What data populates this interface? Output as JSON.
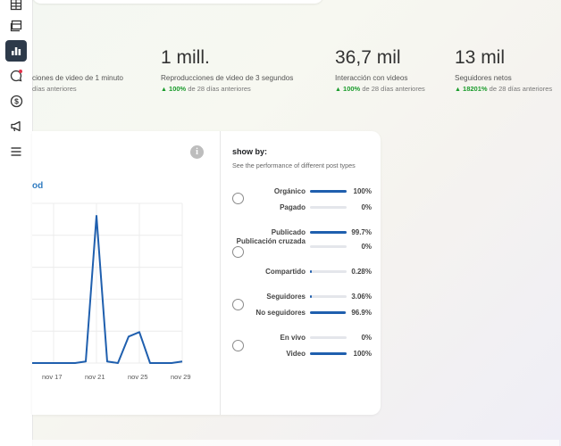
{
  "nav": {
    "items": [
      {
        "icon": "table-icon"
      },
      {
        "icon": "layers-icon"
      },
      {
        "icon": "bar-chart-icon",
        "active": true
      },
      {
        "icon": "chat-icon",
        "badge": true
      },
      {
        "icon": "dollar-icon"
      },
      {
        "icon": "megaphone-icon"
      },
      {
        "icon": "menu-icon"
      }
    ],
    "accent": "#2d3a4a",
    "badge_color": "#e4314b"
  },
  "metrics": [
    {
      "value": "",
      "label": "ciones de video de 1 minuto",
      "change_pct": "",
      "change_text": "días anteriores"
    },
    {
      "value": "1 mill.",
      "label": "Reproducciones de video de 3 segundos",
      "change_pct": "100%",
      "change_text": "de 28 días anteriores"
    },
    {
      "value": "36,7 mil",
      "label": "Interacción con videos",
      "change_pct": "100%",
      "change_text": "de 28 días anteriores"
    },
    {
      "value": "13 mil",
      "label": "Seguidores netos",
      "change_pct": "18201%",
      "change_text": "de 28 días anteriores"
    }
  ],
  "chart": {
    "partial_label": "od",
    "info_icon": "info-icon",
    "line_color": "#1f5fae"
  },
  "chart_data": {
    "type": "line",
    "x": [
      "nov 15",
      "nov 16",
      "nov 17",
      "nov 18",
      "nov 19",
      "nov 20",
      "nov 21",
      "nov 22",
      "nov 23",
      "nov 24",
      "nov 25",
      "nov 26",
      "nov 27",
      "nov 28",
      "nov 29"
    ],
    "y": [
      0,
      0,
      0,
      0,
      0,
      1,
      100,
      1,
      0,
      18,
      21,
      0,
      0,
      0,
      1
    ],
    "x_tick_labels": [
      "nov 17",
      "nov 21",
      "nov 25",
      "nov 29"
    ],
    "grid": true,
    "series": [
      {
        "values": [
          0,
          0,
          0,
          0,
          0,
          1,
          100,
          1,
          0,
          18,
          21,
          0,
          0,
          0,
          1
        ]
      }
    ]
  },
  "show_by": {
    "title": "show by:",
    "subtitle": "See the performance of different post types",
    "groups": [
      {
        "rows": [
          {
            "name": "Orgánico",
            "pct": "100%",
            "value": 100
          },
          {
            "name": "Pagado",
            "pct": "0%",
            "value": 0
          }
        ]
      },
      {
        "rows": [
          {
            "name": "Publicado",
            "pct": "99.7%",
            "value": 99.7
          },
          {
            "name": "Publicación cruzada",
            "pct": "0%",
            "value": 0
          },
          {
            "name": "Compartido",
            "pct": "0.28%",
            "value": 0.28
          }
        ]
      },
      {
        "rows": [
          {
            "name": "Seguidores",
            "pct": "3.06%",
            "value": 3.06
          },
          {
            "name": "No seguidores",
            "pct": "96.9%",
            "value": 96.9
          }
        ]
      },
      {
        "rows": [
          {
            "name": "En vivo",
            "pct": "0%",
            "value": 0
          },
          {
            "name": "Video",
            "pct": "100%",
            "value": 100
          }
        ]
      }
    ]
  }
}
